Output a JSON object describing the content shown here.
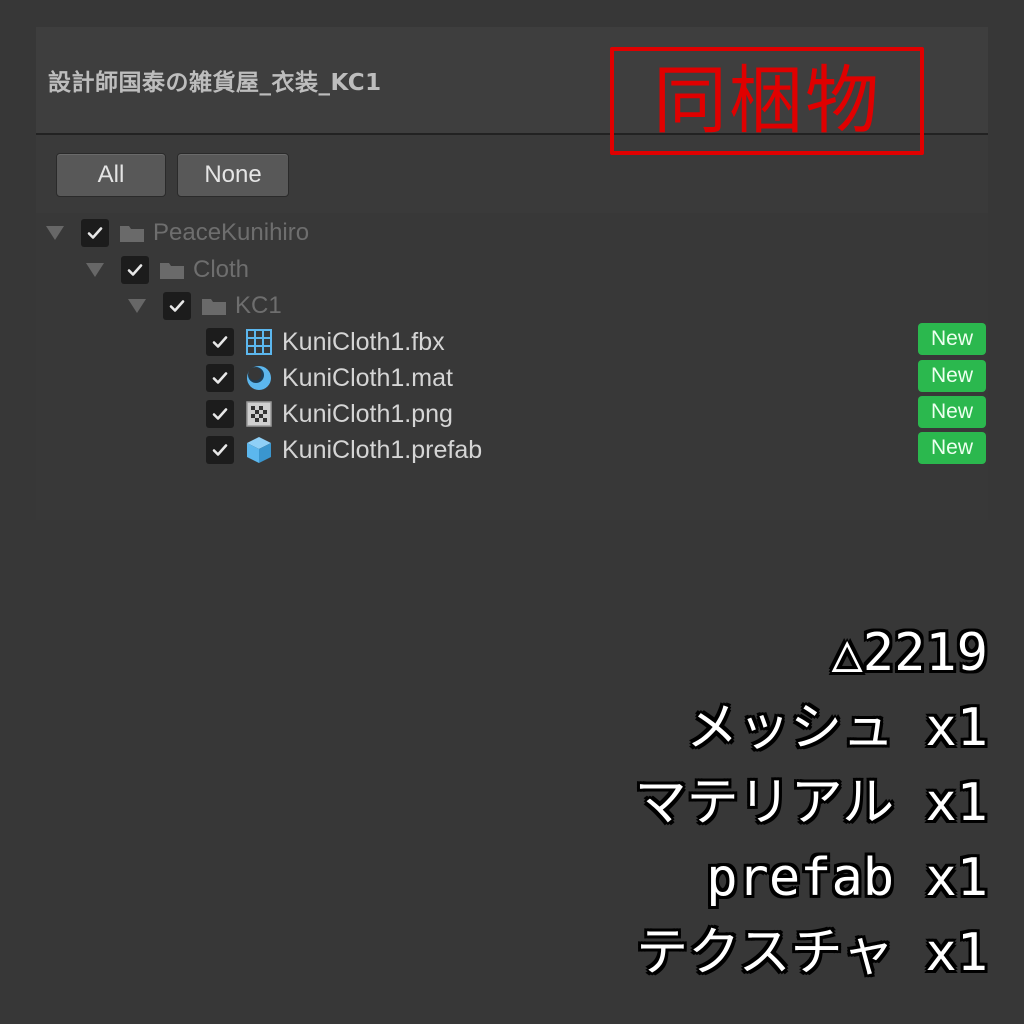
{
  "header": {
    "title": "設計師国泰の雑貨屋_衣装_KC1"
  },
  "stamp": {
    "text": "同梱物",
    "color": "#e00000"
  },
  "toolbar": {
    "all_label": "All",
    "none_label": "None"
  },
  "tree": {
    "folders": [
      {
        "label": "PeaceKunihiro",
        "checked": true,
        "expanded": true
      },
      {
        "label": "Cloth",
        "checked": true,
        "expanded": true
      },
      {
        "label": "KC1",
        "checked": true,
        "expanded": true
      }
    ],
    "files": [
      {
        "label": "KuniCloth1.fbx",
        "icon": "mesh-grid-icon",
        "checked": true,
        "badge": "New"
      },
      {
        "label": "KuniCloth1.mat",
        "icon": "material-sphere-icon",
        "checked": true,
        "badge": "New"
      },
      {
        "label": "KuniCloth1.png",
        "icon": "texture-checker-icon",
        "checked": true,
        "badge": "New"
      },
      {
        "label": "KuniCloth1.prefab",
        "icon": "prefab-cube-icon",
        "checked": true,
        "badge": "New"
      }
    ]
  },
  "stats": [
    "△2219",
    "メッシュ x1",
    "マテリアル x1",
    "prefab x1",
    "テクスチャ x1"
  ],
  "colors": {
    "badge": "#2bb84e",
    "accent_icon": "#5cb7ee",
    "background": "#373737"
  }
}
